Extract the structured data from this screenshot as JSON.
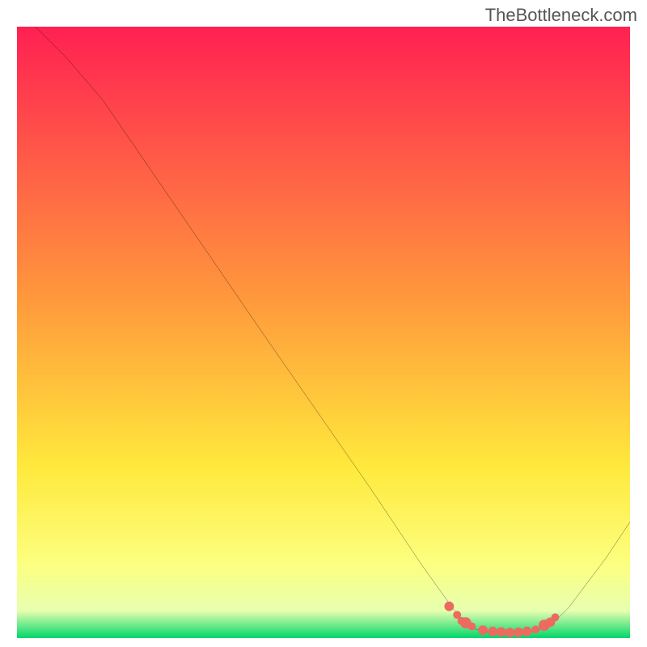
{
  "watermark": "TheBottleneck.com",
  "chart_data": {
    "type": "line",
    "title": "",
    "xlabel": "",
    "ylabel": "",
    "xlim": [
      0,
      100
    ],
    "ylim": [
      0,
      100
    ],
    "background": {
      "type": "vertical-gradient",
      "stops": [
        {
          "pos": 0.0,
          "color": "#ff2052"
        },
        {
          "pos": 0.45,
          "color": "#ff9a3c"
        },
        {
          "pos": 0.72,
          "color": "#ffe93c"
        },
        {
          "pos": 0.88,
          "color": "#fcff80"
        },
        {
          "pos": 0.955,
          "color": "#e8ffb0"
        },
        {
          "pos": 1.0,
          "color": "#00d66a"
        }
      ]
    },
    "series": [
      {
        "name": "curve",
        "color": "#000000",
        "points": [
          {
            "x": 3,
            "y": 100
          },
          {
            "x": 8,
            "y": 95
          },
          {
            "x": 14,
            "y": 88
          },
          {
            "x": 40,
            "y": 50
          },
          {
            "x": 58,
            "y": 24
          },
          {
            "x": 66,
            "y": 12
          },
          {
            "x": 71,
            "y": 5
          },
          {
            "x": 73.5,
            "y": 2
          },
          {
            "x": 76,
            "y": 1
          },
          {
            "x": 80,
            "y": 0.8
          },
          {
            "x": 84,
            "y": 1
          },
          {
            "x": 87,
            "y": 2
          },
          {
            "x": 90,
            "y": 5
          },
          {
            "x": 96,
            "y": 13
          },
          {
            "x": 100,
            "y": 19
          }
        ]
      }
    ],
    "markers": [
      {
        "x": 70.5,
        "y": 5.2,
        "r": 6
      },
      {
        "x": 71.8,
        "y": 3.8,
        "r": 5
      },
      {
        "x": 72.5,
        "y": 2.8,
        "r": 5
      },
      {
        "x": 73.2,
        "y": 2.5,
        "r": 7
      },
      {
        "x": 74.2,
        "y": 1.9,
        "r": 5
      },
      {
        "x": 76.0,
        "y": 1.3,
        "r": 6
      },
      {
        "x": 77.6,
        "y": 1.1,
        "r": 6
      },
      {
        "x": 79.0,
        "y": 1.0,
        "r": 6
      },
      {
        "x": 80.4,
        "y": 0.9,
        "r": 6
      },
      {
        "x": 81.8,
        "y": 0.95,
        "r": 6
      },
      {
        "x": 83.2,
        "y": 1.1,
        "r": 6
      },
      {
        "x": 84.6,
        "y": 1.4,
        "r": 5
      },
      {
        "x": 86.0,
        "y": 2.1,
        "r": 7
      },
      {
        "x": 87.0,
        "y": 2.6,
        "r": 6
      },
      {
        "x": 87.8,
        "y": 3.4,
        "r": 5
      }
    ],
    "marker_color": "#ec6a5f"
  }
}
